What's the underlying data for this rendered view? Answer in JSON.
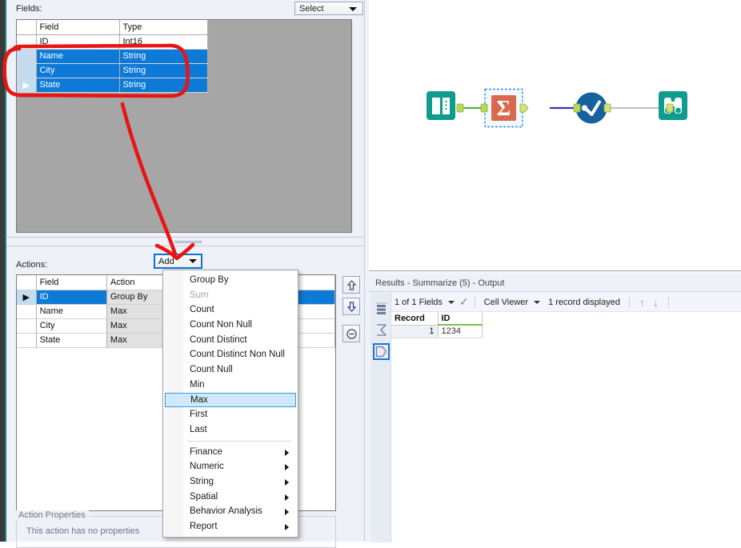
{
  "config_panel": {
    "fields_label": "Fields:",
    "actions_label": "Actions:",
    "select_dropdown": {
      "label": "Select",
      "icon": "chevron-down-icon"
    },
    "add_button": {
      "label": "Add",
      "icon": "chevron-down-icon"
    },
    "fields_table": {
      "columns": [
        "",
        "Field",
        "Type"
      ],
      "rows": [
        {
          "marker": "",
          "field": "ID",
          "type": "Int16",
          "selected": false
        },
        {
          "marker": "",
          "field": "Name",
          "type": "String",
          "selected": true
        },
        {
          "marker": "",
          "field": "City",
          "type": "String",
          "selected": true
        },
        {
          "marker": "▶",
          "field": "State",
          "type": "String",
          "selected": true
        }
      ]
    },
    "actions_table": {
      "columns": [
        "",
        "Field",
        "Action",
        ""
      ],
      "rows": [
        {
          "marker": "▶",
          "field": "ID",
          "action": "Group By",
          "output": "",
          "selected": true
        },
        {
          "marker": "",
          "field": "Name",
          "action": "Max",
          "output": "",
          "selected": false
        },
        {
          "marker": "",
          "field": "City",
          "action": "Max",
          "output": "",
          "selected": false
        },
        {
          "marker": "",
          "field": "State",
          "action": "Max",
          "output": "",
          "selected": false
        }
      ]
    },
    "side_buttons": [
      {
        "name": "move-up-button",
        "icon": "arrow-up-icon"
      },
      {
        "name": "move-down-button",
        "icon": "arrow-down-icon"
      },
      {
        "name": "remove-button",
        "icon": "minus-circle-icon"
      }
    ],
    "action_properties": {
      "legend": "Action Properties",
      "message": "This action has no properties"
    }
  },
  "add_menu": {
    "items": [
      {
        "label": "Group By",
        "state": "normal",
        "submenu": false
      },
      {
        "label": "Sum",
        "state": "disabled",
        "submenu": false
      },
      {
        "label": "Count",
        "state": "normal",
        "submenu": false
      },
      {
        "label": "Count Non Null",
        "state": "normal",
        "submenu": false
      },
      {
        "label": "Count Distinct",
        "state": "normal",
        "submenu": false
      },
      {
        "label": "Count Distinct Non Null",
        "state": "normal",
        "submenu": false
      },
      {
        "label": "Count Null",
        "state": "normal",
        "submenu": false
      },
      {
        "label": "Min",
        "state": "normal",
        "submenu": false
      },
      {
        "label": "Max",
        "state": "highlighted",
        "submenu": false
      },
      {
        "label": "First",
        "state": "normal",
        "submenu": false
      },
      {
        "label": "Last",
        "state": "normal",
        "submenu": false
      },
      {
        "separator": true
      },
      {
        "label": "Finance",
        "state": "normal",
        "submenu": true
      },
      {
        "label": "Numeric",
        "state": "normal",
        "submenu": true
      },
      {
        "label": "String",
        "state": "normal",
        "submenu": true
      },
      {
        "label": "Spatial",
        "state": "normal",
        "submenu": true
      },
      {
        "label": "Behavior Analysis",
        "state": "normal",
        "submenu": true
      },
      {
        "label": "Report",
        "state": "normal",
        "submenu": true
      }
    ]
  },
  "canvas": {
    "tools": [
      {
        "name": "input-data-tool",
        "icon": "book-icon",
        "color": "#0f9b8e",
        "selected": false
      },
      {
        "name": "summarize-tool",
        "icon": "sigma-icon",
        "color": "#d9684f",
        "selected": true
      },
      {
        "name": "browse-select-tool",
        "icon": "check-circle-icon",
        "color": "#15629f",
        "selected": false
      },
      {
        "name": "browse-tool",
        "icon": "binoculars-icon",
        "color": "#0f9b8e",
        "selected": false
      }
    ],
    "connections": [
      {
        "from": "input-data-tool",
        "to": "summarize-tool",
        "color": "#4caf50"
      },
      {
        "from": "summarize-tool",
        "to": "browse-select-tool",
        "color": "#3a2fd0"
      },
      {
        "from": "browse-select-tool",
        "to": "browse-tool",
        "color": "#b0b0b0"
      }
    ]
  },
  "results": {
    "title": "Results - Summarize (5) - Output",
    "rail_icons": [
      {
        "name": "config-list-icon",
        "glyph": "list"
      },
      {
        "name": "sigma-icon",
        "glyph": "sigma"
      },
      {
        "name": "output-anchor-icon",
        "glyph": "pentagon",
        "selected": true
      }
    ],
    "toolbar": {
      "fields_label": "1 of 1 Fields",
      "check_icon": "checkmark-icon",
      "viewer_label": "Cell Viewer",
      "record_count": "1 record displayed",
      "up_icon": "arrow-up-icon",
      "down_icon": "arrow-down-icon"
    },
    "grid": {
      "columns": [
        "Record",
        "ID"
      ],
      "rows": [
        {
          "record": "1",
          "id": "1234"
        }
      ]
    }
  },
  "annotation": {
    "color": "#e81515",
    "shapes": [
      "rounded-rect-highlight",
      "curved-arrow"
    ]
  }
}
